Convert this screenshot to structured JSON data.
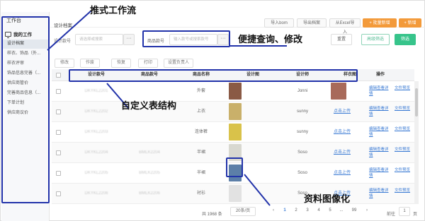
{
  "sidebar": {
    "title": "工作台",
    "home": "我的工作",
    "items": [
      {
        "label": "设计档案"
      },
      {
        "label": "样衣、饰品（外..."
      },
      {
        "label": "样衣评审"
      },
      {
        "label": "饰品信息完善（..."
      },
      {
        "label": "供应商管价"
      },
      {
        "label": "完善商品信息（..."
      },
      {
        "label": "下单计划"
      },
      {
        "label": "供应商议价"
      }
    ]
  },
  "header": {
    "page_title": "设计档案",
    "buttons": {
      "import_bom": "导入bom",
      "export_file": "导出档案",
      "excel_import": "从Excel导入",
      "batch_new": "+ 批量新增",
      "new": "+ 新增"
    }
  },
  "search": {
    "design_no_label": "设计款号",
    "design_no_placeholder": "请选择或搜索",
    "goods_no_label": "商品款号",
    "goods_no_placeholder": "输入款号或搜索款号",
    "ellipsis": "···",
    "reset": "重置",
    "advanced": "高级筛选",
    "filter": "筛选"
  },
  "toolbar": {
    "revise": "修改",
    "void": "作废",
    "restore": "恢复",
    "print": "打印",
    "assign": "设置负责人"
  },
  "table": {
    "columns": [
      "设计款号",
      "商品款号",
      "商品名称",
      "设计图",
      "设计师",
      "样衣图",
      "操作"
    ],
    "rows": [
      {
        "design_no": "DKYKL2201",
        "goods_no": "",
        "name": "外套",
        "designer": "Jonni",
        "sample": "image",
        "ops": [
          "编辑查看详情",
          "文件预览"
        ],
        "design_color": "#8a5a45"
      },
      {
        "design_no": "DKYKL2202",
        "goods_no": "",
        "name": "上衣",
        "designer": "sunny",
        "sample": "点击上传",
        "ops": [
          "编辑查看详情",
          "文件预览"
        ],
        "design_color": "#c9b06a"
      },
      {
        "design_no": "DKYKL2203",
        "goods_no": "",
        "name": "连体裤",
        "designer": "sunny",
        "sample": "点击上传",
        "ops": [
          "编辑查看详情",
          "文件预览"
        ],
        "design_color": "#d9c24a"
      },
      {
        "design_no": "DKYKL2204",
        "goods_no": "BMLK2204",
        "name": "半裙",
        "designer": "Soso",
        "sample": "点击上传",
        "ops": [
          "编辑查看详情",
          "文件预览"
        ],
        "design_color": "#d8d8d0"
      },
      {
        "design_no": "DKYKL2205",
        "goods_no": "BMLK2205",
        "name": "半裙",
        "designer": "Soso",
        "sample": "点击上传",
        "ops": [
          "编辑查看详情",
          "文件预览"
        ],
        "design_color": "#5c7fa8"
      },
      {
        "design_no": "DKYKL2206",
        "goods_no": "BMLK2206",
        "name": "衬衫",
        "designer": "Soso",
        "sample": "点击上传",
        "ops": [
          "编辑查看详情",
          "文件预览"
        ],
        "design_color": "#e2e2e2"
      }
    ]
  },
  "pagination": {
    "total": "共 1968 条",
    "page_size": "20条/页",
    "pages": [
      "1",
      "2",
      "3",
      "4",
      "5",
      "...",
      "99"
    ],
    "prev": "‹",
    "next": "›",
    "goto_label": "前往",
    "goto_value": "1",
    "page_unit": "页"
  },
  "annotations": {
    "workflow": "推式工作流",
    "query_edit": "便捷查询、修改",
    "custom_table": "自定义表结构",
    "image_data": "资料图像化"
  },
  "colors": {
    "accent_orange": "#f39a3a",
    "accent_green": "#37c48b",
    "link_blue": "#3b7bd4",
    "annotation_navy": "#2233aa"
  }
}
